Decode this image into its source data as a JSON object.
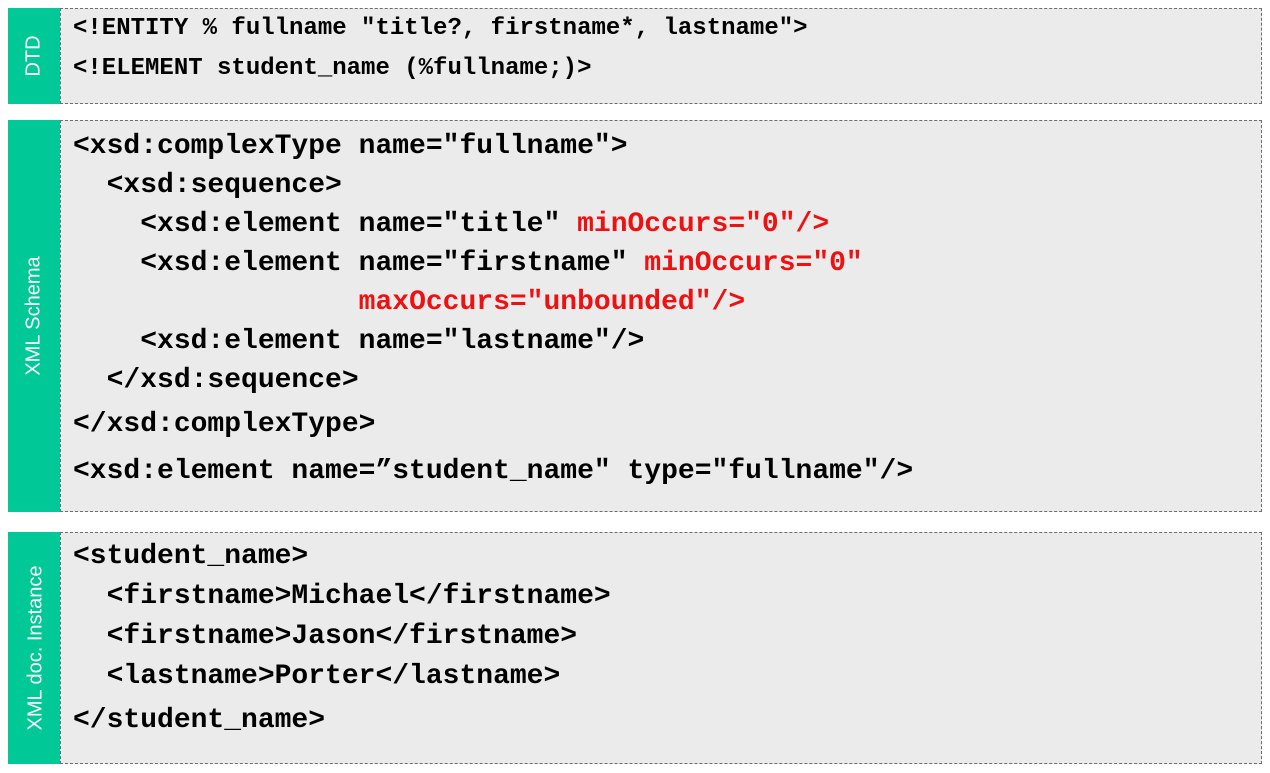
{
  "panels": {
    "dtd": {
      "label": "DTD",
      "lines": [
        {
          "text": "<!ENTITY % fullname \"title?, firstname*, lastname\">"
        },
        {
          "text": "<!ELEMENT student_name (%fullname;)>"
        }
      ]
    },
    "schema": {
      "label": "XML Schema",
      "lines": [
        {
          "text": "<xsd:complexType name=\"fullname\">"
        },
        {
          "text": "  <xsd:sequence>"
        },
        {
          "text": "    <xsd:element name=\"title\" ",
          "highlight": "minOccurs=\"0\"/>"
        },
        {
          "text": "    <xsd:element name=\"firstname\" ",
          "highlight": "minOccurs=\"0\""
        },
        {
          "text": "                 ",
          "highlight": "maxOccurs=\"unbounded\"/>"
        },
        {
          "text": "    <xsd:element name=\"lastname\"/>"
        },
        {
          "text": "  </xsd:sequence>"
        },
        {
          "text": "</xsd:complexType>"
        },
        {
          "text": "<xsd:element name=”student_name\" type=\"fullname\"/>"
        }
      ]
    },
    "instance": {
      "label": "XML doc. Instance",
      "lines": [
        {
          "text": "<student_name>"
        },
        {
          "text": "  <firstname>Michael</firstname>"
        },
        {
          "text": "  <firstname>Jason</firstname>"
        },
        {
          "text": "  <lastname>Porter</lastname>"
        },
        {
          "text": "</student_name>"
        }
      ]
    }
  },
  "colors": {
    "tab": "#00c896",
    "highlight": "#ee1111",
    "box_background": "#ebebeb"
  }
}
